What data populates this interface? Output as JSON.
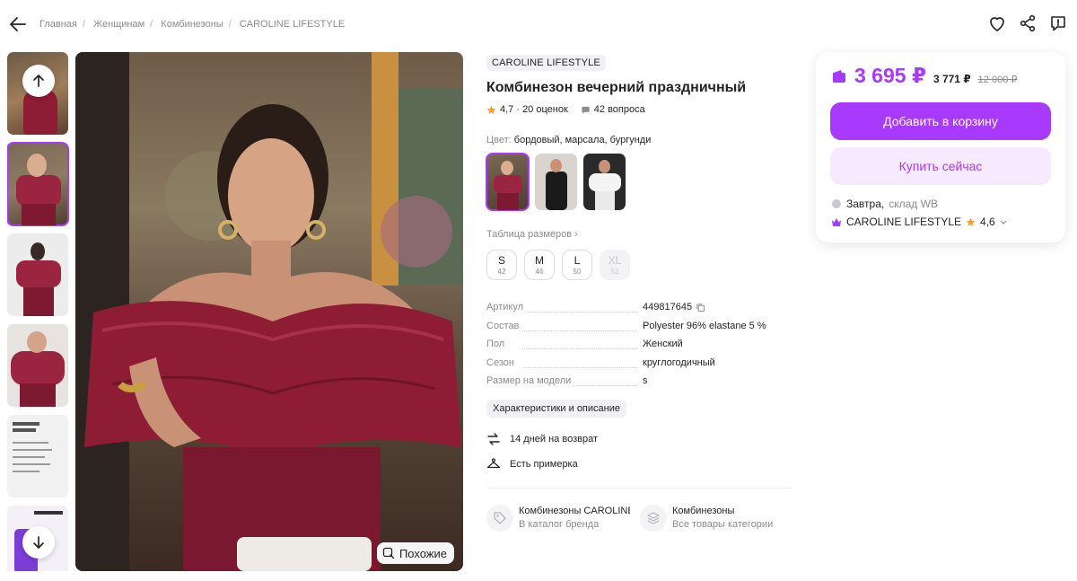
{
  "breadcrumbs": [
    "Главная",
    "Женщинам",
    "Комбинезоны",
    "CAROLINE LIFESTYLE"
  ],
  "gallery": {
    "similar_label": "Похожие",
    "thumb_count": 6
  },
  "product": {
    "brand": "CAROLINE LIFESTYLE",
    "title": "Комбинезон вечерний праздничный",
    "rating_text": "4,7 · 20 оценок",
    "questions_text": "42 вопроса",
    "color_label": "Цвет:",
    "color_value": "бордовый, марсала, бургунди",
    "size_table_label": "Таблица размеров",
    "sizes": [
      {
        "label": "S",
        "ru": "42",
        "available": true
      },
      {
        "label": "M",
        "ru": "46",
        "available": true
      },
      {
        "label": "L",
        "ru": "50",
        "available": true
      },
      {
        "label": "XL",
        "ru": "52",
        "available": false
      }
    ],
    "specs": [
      {
        "key": "Артикул",
        "value": "449817645"
      },
      {
        "key": "Состав",
        "value": "Polyester 96% elastane 5 %"
      },
      {
        "key": "Пол",
        "value": "Женский"
      },
      {
        "key": "Сезон",
        "value": "круглогодичный"
      },
      {
        "key": "Размер на модели",
        "value": "s"
      }
    ],
    "specs_button": "Характеристики и описание",
    "features": [
      "14 дней на возврат",
      "Есть примерка"
    ],
    "links": [
      {
        "title": "Комбинезоны CAROLINE LIFESTYLE",
        "subtitle": "В каталог бренда"
      },
      {
        "title": "Комбинезоны",
        "subtitle": "Все товары категории"
      }
    ]
  },
  "price_card": {
    "price": "3 695 ₽",
    "price_wallet": "3 771 ₽",
    "price_old": "12 000 ₽",
    "add_to_cart": "Добавить в корзину",
    "buy_now": "Купить сейчас",
    "delivery_day": "Завтра,",
    "delivery_place": "склад WB",
    "seller_name": "CAROLINE LIFESTYLE",
    "seller_rating": "4,6"
  },
  "colors": {
    "accent": "#a73afd",
    "accent_light": "#f7e9ff",
    "star": "#ff9f29",
    "dress": "#8e1c35"
  },
  "icons": [
    "back-arrow-icon",
    "heart-icon",
    "share-icon",
    "report-icon",
    "arrow-up-icon",
    "arrow-down-icon",
    "star-icon",
    "question-icon",
    "copy-icon",
    "return-icon",
    "hanger-icon",
    "tag-icon",
    "catalog-icon",
    "wallet-icon",
    "warehouse-icon",
    "crown-icon",
    "search-similar-icon"
  ]
}
